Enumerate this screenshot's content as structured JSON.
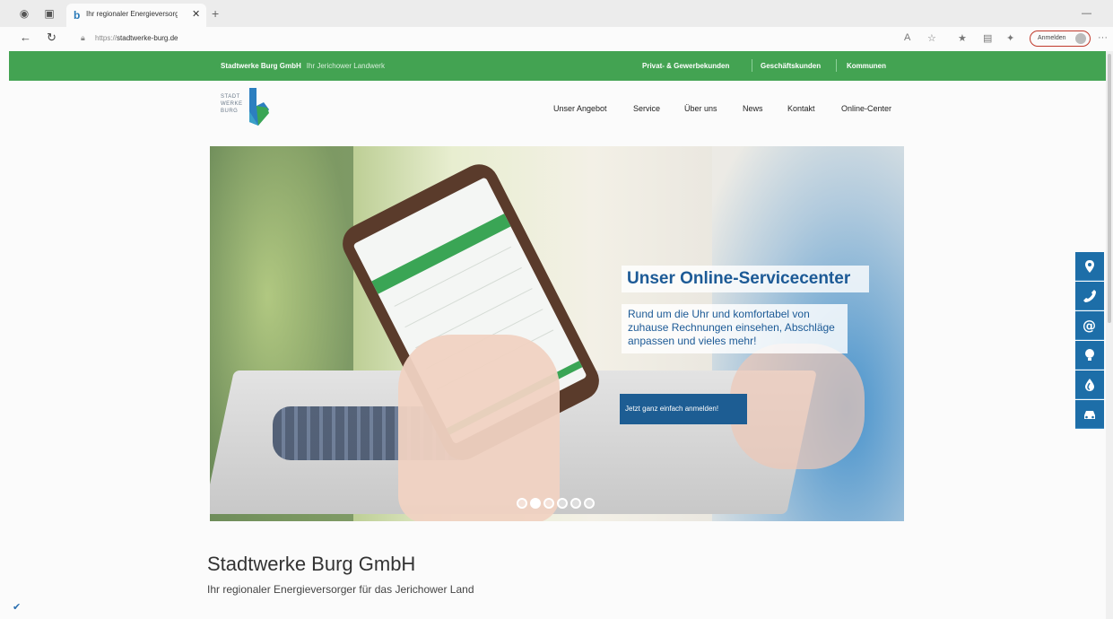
{
  "browser": {
    "tab_title": "Ihr regionaler Energieversorger",
    "new_tab": "+",
    "url_scheme": "https://",
    "url_host": "stadtwerke-burg.de",
    "signin_label": "Anmelden",
    "more": "···",
    "minimize": "—"
  },
  "site": {
    "topbar": {
      "brand": "Stadtwerke Burg GmbH",
      "brand_sub": "Ihr Jerichower Landwerk",
      "links": [
        "Privat- & Gewerbekunden",
        "Geschäftskunden",
        "Kommunen"
      ]
    },
    "logo": {
      "line1": "STADT",
      "line2": "WERKE",
      "line3": "BURG"
    },
    "nav": [
      "Unser Angebot",
      "Service",
      "Über uns",
      "News",
      "Kontakt",
      "Online-Center"
    ],
    "hero": {
      "title": "Unser Online-Servicecenter",
      "text": "Rund um die Uhr und komfortabel von zuhause Rechnungen einsehen, Abschläge anpassen und vieles mehr!",
      "cta": "Jetzt ganz einfach anmelden!",
      "slides": 6,
      "active_slide": 2
    },
    "headline": "Stadtwerke Burg GmbH",
    "subline": "Ihr regionaler Energieversorger für das Jerichower Land",
    "sidebar_icons": [
      "location-icon",
      "phone-icon",
      "at-icon",
      "lightbulb-icon",
      "drop-icon",
      "car-icon"
    ]
  },
  "colors": {
    "green": "#43a352",
    "blue": "#1d6ea8",
    "heading_blue": "#1c5a96"
  }
}
